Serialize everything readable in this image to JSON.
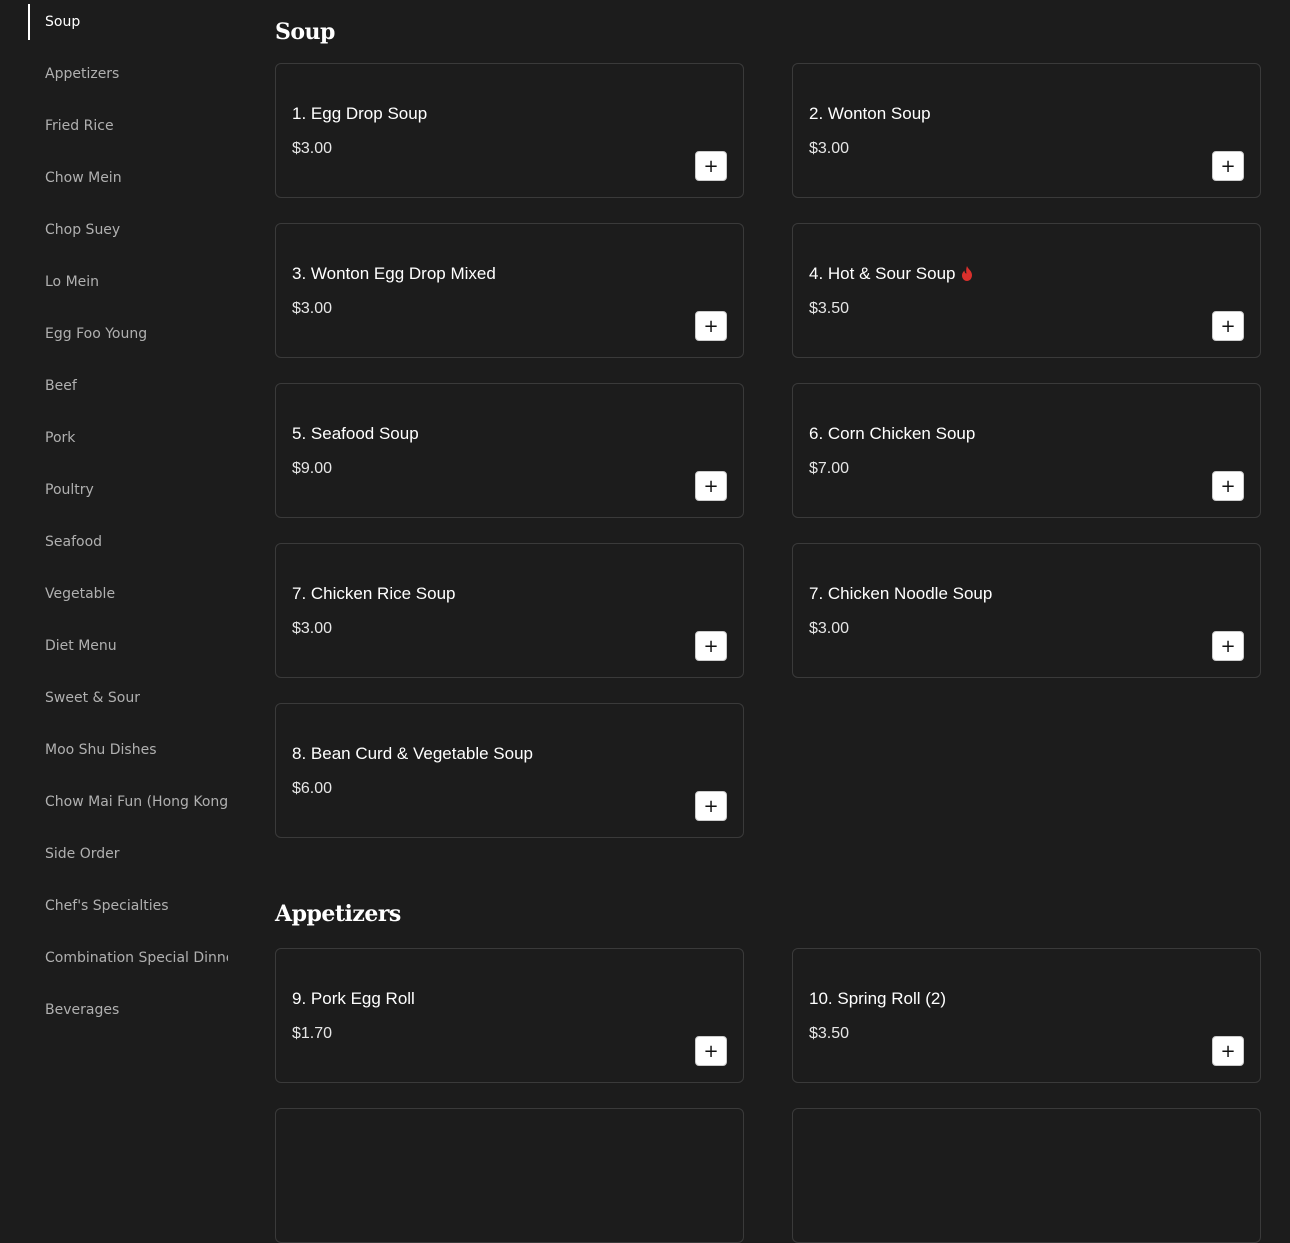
{
  "sidebar": {
    "items": [
      "Soup",
      "Appetizers",
      "Fried Rice",
      "Chow Mein",
      "Chop Suey",
      "Lo Mein",
      "Egg Foo Young",
      "Beef",
      "Pork",
      "Poultry",
      "Seafood",
      "Vegetable",
      "Diet Menu",
      "Sweet & Sour",
      "Moo Shu Dishes",
      "Chow Mai Fun (Hong Kong",
      "Side Order",
      "Chef's Specialties",
      "Combination Special Dinne",
      "Beverages"
    ],
    "active": "Soup"
  },
  "sections": [
    {
      "title": "Soup",
      "items": [
        {
          "name": "1. Egg Drop Soup",
          "price": "$3.00"
        },
        {
          "name": "2. Wonton Soup",
          "price": "$3.00"
        },
        {
          "name": "3. Wonton Egg Drop Mixed",
          "price": "$3.00"
        },
        {
          "name": "4. Hot & Sour Soup",
          "price": "$3.50",
          "icon": "spicy-flame-icon"
        },
        {
          "name": "5. Seafood Soup",
          "price": "$9.00"
        },
        {
          "name": "6. Corn Chicken Soup",
          "price": "$7.00"
        },
        {
          "name": "7. Chicken Rice Soup",
          "price": "$3.00"
        },
        {
          "name": "7. Chicken Noodle Soup",
          "price": "$3.00"
        },
        {
          "name": "8. Bean Curd & Vegetable Soup",
          "price": "$6.00"
        }
      ]
    },
    {
      "title": "Appetizers",
      "items": [
        {
          "name": "9. Pork Egg Roll",
          "price": "$1.70"
        },
        {
          "name": "10. Spring Roll (2)",
          "price": "$3.50"
        },
        {
          "name": "",
          "price": ""
        },
        {
          "name": "",
          "price": ""
        }
      ]
    }
  ],
  "add_button_label": "+",
  "colors": {
    "background": "#1c1c1c",
    "card_border": "#3a3a3a",
    "sidebar_text": "#b0b0b0",
    "active_text": "#ffffff",
    "spicy": "#d9302c"
  }
}
